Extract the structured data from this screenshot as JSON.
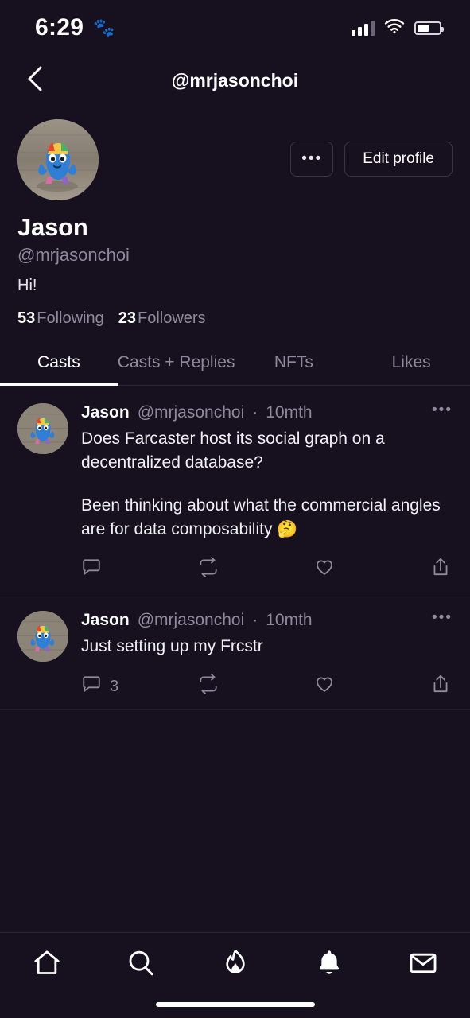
{
  "status_bar": {
    "time": "6:29",
    "paw_icon": "paw-icon",
    "signal_icon": "cellular-signal-icon",
    "wifi_icon": "wifi-icon",
    "battery_icon": "battery-icon"
  },
  "nav": {
    "back_icon": "chevron-left-icon",
    "title": "@mrjasonchoi"
  },
  "profile": {
    "avatar": "user-avatar",
    "more_label": "•••",
    "edit_label": "Edit profile",
    "display_name": "Jason",
    "handle": "@mrjasonchoi",
    "bio": "Hi!",
    "following_count": "53",
    "following_label": "Following",
    "followers_count": "23",
    "followers_label": "Followers"
  },
  "tabs": [
    {
      "label": "Casts",
      "active": true
    },
    {
      "label": "Casts + Replies",
      "active": false
    },
    {
      "label": "NFTs",
      "active": false
    },
    {
      "label": "Likes",
      "active": false
    }
  ],
  "casts": [
    {
      "author": "Jason",
      "handle": "@mrjasonchoi",
      "separator": "·",
      "time": "10mth",
      "more_label": "•••",
      "paragraphs": [
        "Does Farcaster host its social graph on a decentralized database?",
        "Been thinking about what the commercial angles are for data composability 🤔"
      ],
      "reply_count": "",
      "recast_count": "",
      "like_count": ""
    },
    {
      "author": "Jason",
      "handle": "@mrjasonchoi",
      "separator": "·",
      "time": "10mth",
      "more_label": "•••",
      "paragraphs": [
        "Just setting up my Frcstr"
      ],
      "reply_count": "3",
      "recast_count": "",
      "like_count": ""
    }
  ],
  "cast_actions": {
    "reply_icon": "comment-icon",
    "recast_icon": "recast-icon",
    "like_icon": "heart-icon",
    "share_icon": "share-icon"
  },
  "tabbar": [
    {
      "icon": "home-icon",
      "name": "tabbar-home"
    },
    {
      "icon": "search-icon",
      "name": "tabbar-search"
    },
    {
      "icon": "flame-icon",
      "name": "tabbar-trending"
    },
    {
      "icon": "bell-icon",
      "name": "tabbar-notifications"
    },
    {
      "icon": "envelope-icon",
      "name": "tabbar-messages"
    }
  ],
  "colors": {
    "background": "#17101f",
    "text_primary": "#ffffff",
    "text_muted": "#8f8a9b",
    "border": "#2b2438"
  }
}
